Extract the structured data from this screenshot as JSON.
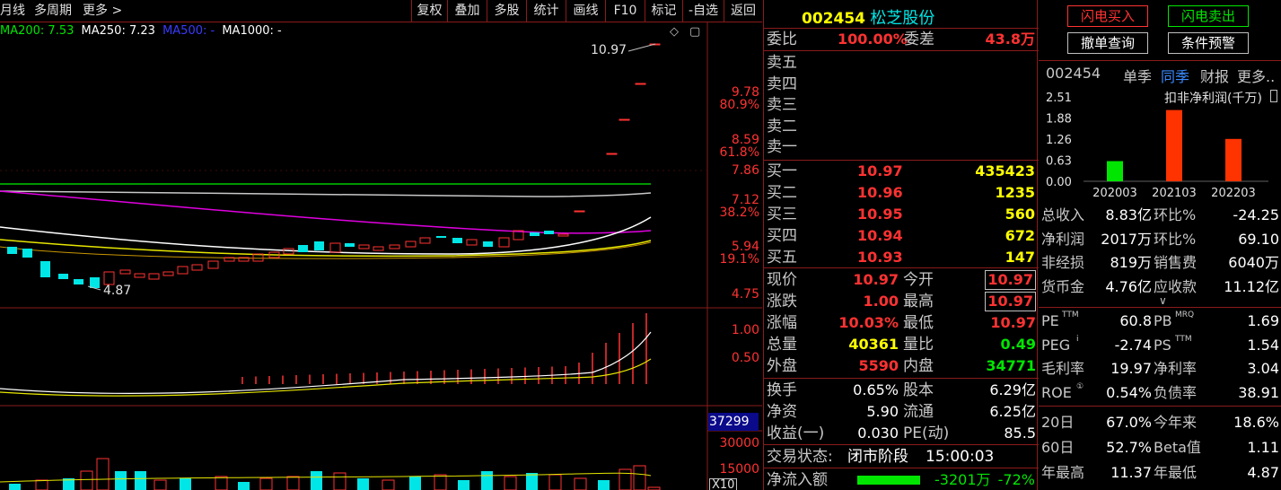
{
  "toolbar": {
    "left_items": [
      "月线",
      "多周期",
      "更多 >"
    ],
    "buttons": [
      "复权",
      "叠加",
      "多股",
      "统计",
      "画线",
      "F10",
      "标记",
      "-自选",
      "返回"
    ]
  },
  "ma_legend": {
    "ma200": "MA200: 7.53",
    "ma250": "MA250: 7.23",
    "ma500": "MA500: -",
    "ma1000": "MA1000: -"
  },
  "price_axis": [
    {
      "label": "9.78",
      "pct": "80.9%"
    },
    {
      "label": "8.59",
      "pct": "61.8%"
    },
    {
      "label": "7.86",
      "pct": ""
    },
    {
      "label": "7.12",
      "pct": "38.2%"
    },
    {
      "label": "5.94",
      "pct": "19.1%"
    },
    {
      "label": "4.75",
      "pct": ""
    }
  ],
  "chart_annotations": {
    "high_label": "10.97",
    "low_label": "4.87"
  },
  "indicator_axis": [
    "1.00",
    "0.50"
  ],
  "volume_axis": {
    "current": "37299",
    "ticks": [
      "30000",
      "15000"
    ],
    "unit": "X10"
  },
  "stock": {
    "code": "002454",
    "name": "松芝股份"
  },
  "weibi": {
    "label": "委比",
    "value": "100.00%",
    "diff_label": "委差",
    "diff_value": "43.8万"
  },
  "sell_levels": [
    "卖五",
    "卖四",
    "卖三",
    "卖二",
    "卖一"
  ],
  "buy_levels": [
    {
      "label": "买一",
      "price": "10.97",
      "vol": "435423"
    },
    {
      "label": "买二",
      "price": "10.96",
      "vol": "1235"
    },
    {
      "label": "买三",
      "price": "10.95",
      "vol": "560"
    },
    {
      "label": "买四",
      "price": "10.94",
      "vol": "672"
    },
    {
      "label": "买五",
      "price": "10.93",
      "vol": "147"
    }
  ],
  "quote_stats": [
    {
      "l1": "现价",
      "v1": "10.97",
      "l2": "今开",
      "v2": "10.97"
    },
    {
      "l1": "涨跌",
      "v1": "1.00",
      "l2": "最高",
      "v2": "10.97"
    },
    {
      "l1": "涨幅",
      "v1": "10.03%",
      "l2": "最低",
      "v2": "10.97"
    },
    {
      "l1": "总量",
      "v1": "40361",
      "l2": "量比",
      "v2": "0.49"
    },
    {
      "l1": "外盘",
      "v1": "5590",
      "l2": "内盘",
      "v2": "34771"
    }
  ],
  "quote_stats2": [
    {
      "l1": "换手",
      "v1": "0.65%",
      "l2": "股本",
      "v2": "6.29亿"
    },
    {
      "l1": "净资",
      "v1": "5.90",
      "l2": "流通",
      "v2": "6.25亿"
    },
    {
      "l1": "收益(一)",
      "v1": "0.030",
      "l2": "PE(动)",
      "v2": "85.5"
    }
  ],
  "trade_status": {
    "label": "交易状态:",
    "value": "闭市阶段",
    "time": "15:00:03"
  },
  "net_flow": {
    "label": "净流入额",
    "value": "-3201万",
    "pct": "-72%"
  },
  "actions": {
    "flash_buy": "闪电买入",
    "flash_sell": "闪电卖出",
    "cancel_query": "撤单查询",
    "condition_alert": "条件预警"
  },
  "fin_header": {
    "code": "002454",
    "tab1": "单季",
    "tab2": "同季",
    "tab3": "财报",
    "more": "更多.."
  },
  "chart_data": {
    "type": "bar",
    "title": "扣非净利润(千万)",
    "categories": [
      "202003",
      "202103",
      "202203"
    ],
    "values": [
      0.6,
      2.12,
      1.26
    ],
    "colors": [
      "#00e600",
      "#ff3300",
      "#ff3300"
    ],
    "yticks": [
      "2.51",
      "1.88",
      "1.26",
      "0.63",
      "0.00"
    ],
    "ylim": [
      0,
      2.51
    ]
  },
  "fin_rows": [
    {
      "l1": "总收入",
      "v1": "8.83亿",
      "l2": "环比%",
      "v2": "-24.25"
    },
    {
      "l1": "净利润",
      "v1": "2017万",
      "l2": "环比%",
      "v2": "69.10"
    },
    {
      "l1": "非经损",
      "v1": "819万",
      "l2": "销售费",
      "v2": "6040万"
    },
    {
      "l1": "货币金",
      "v1": "4.76亿",
      "l2": "应收款",
      "v2": "11.12亿"
    }
  ],
  "fin_rows2": [
    {
      "l1": "PE",
      "sup1": "TTM",
      "v1": "60.8",
      "l2": "PB",
      "sup2": "MRQ",
      "v2": "1.69"
    },
    {
      "l1": "PEG",
      "sup1": "i",
      "v1": "-2.74",
      "l2": "PS",
      "sup2": "TTM",
      "v2": "1.54"
    },
    {
      "l1": "毛利率",
      "sup1": "",
      "v1": "19.97",
      "l2": "净利率",
      "sup2": "",
      "v2": "3.04"
    },
    {
      "l1": "ROE",
      "sup1": "①",
      "v1": "0.54%",
      "l2": "负债率",
      "sup2": "",
      "v2": "38.91"
    }
  ],
  "fin_rows3": [
    {
      "l1": "20日",
      "v1": "67.0%",
      "l2": "今年来",
      "v2": "18.6%"
    },
    {
      "l1": "60日",
      "v1": "52.7%",
      "l2": "Beta值",
      "v2": "1.11"
    },
    {
      "l1": "年最高",
      "v1": "11.37",
      "l2": "年最低",
      "v2": "4.87"
    }
  ]
}
